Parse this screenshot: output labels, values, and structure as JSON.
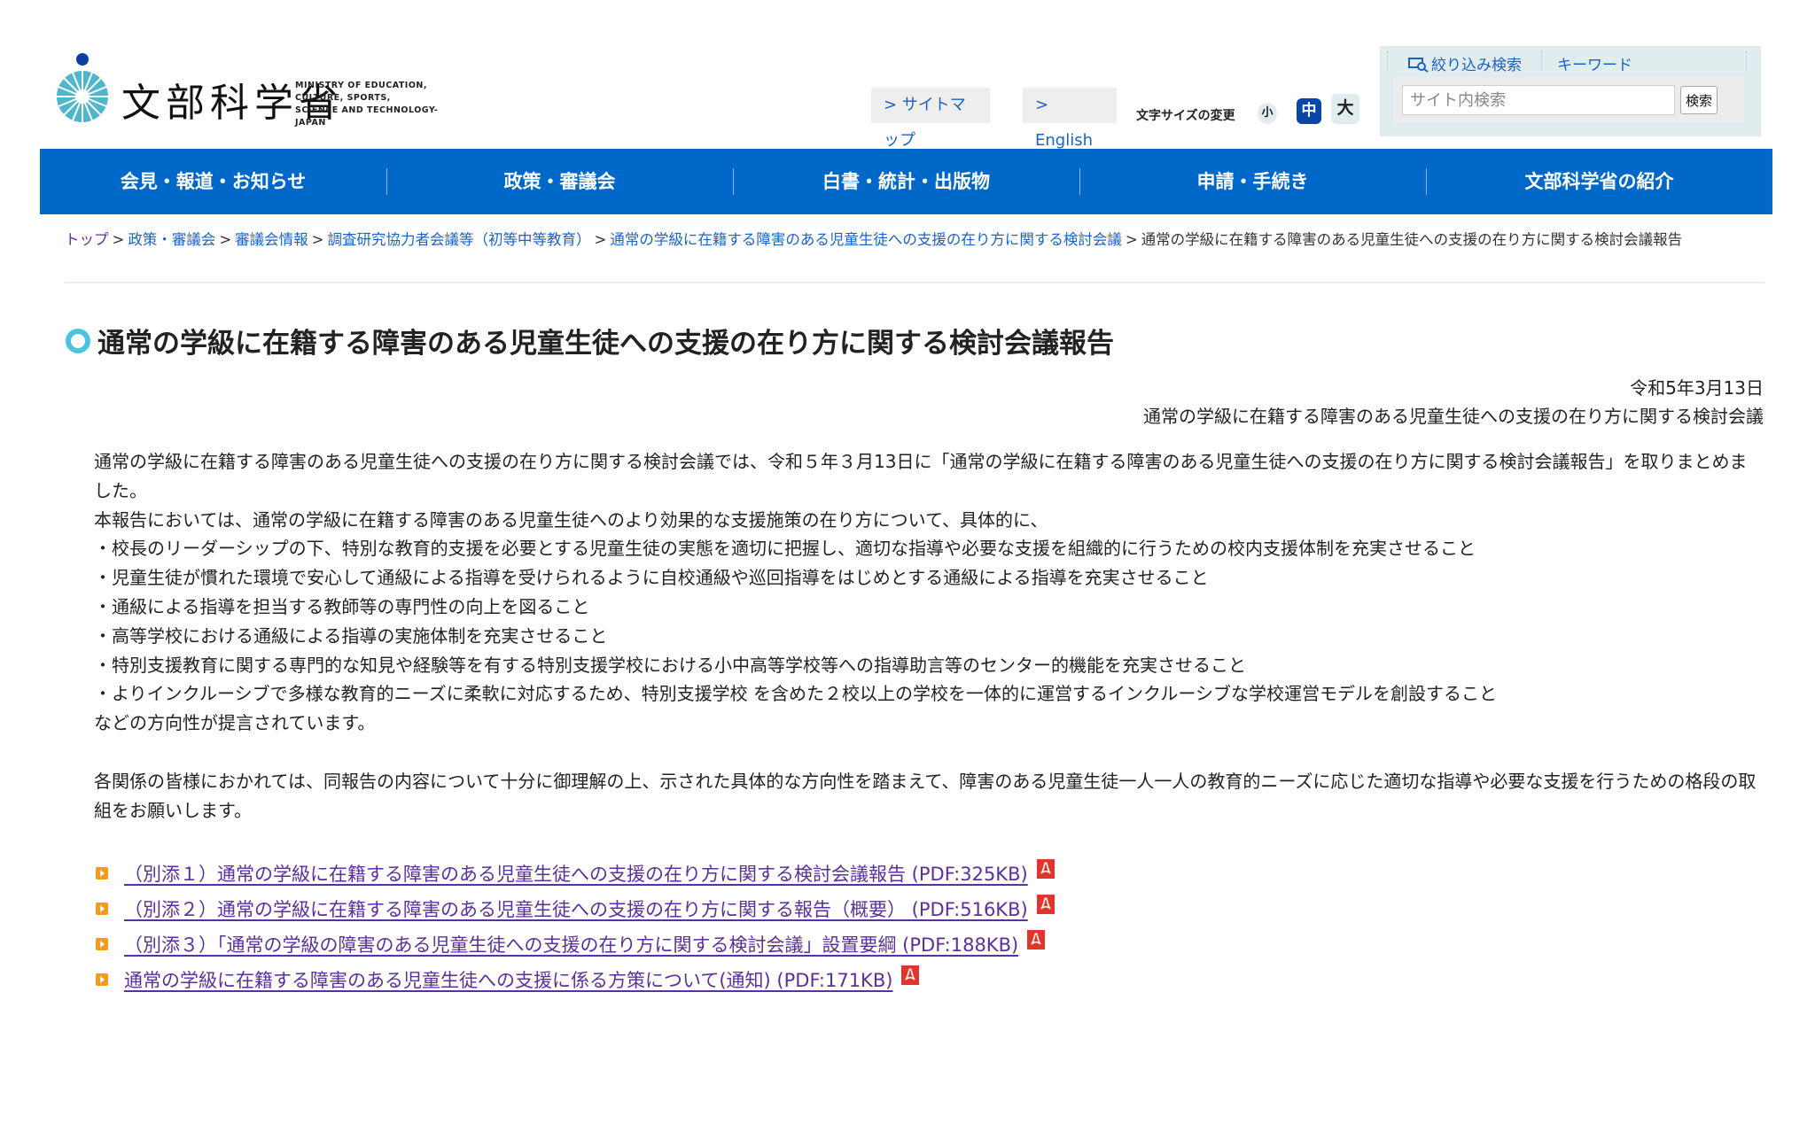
{
  "header": {
    "logo_kanji": "文部科学省",
    "logo_english": [
      "MINISTRY OF EDUCATION,",
      "CULTURE, SPORTS,",
      "SCIENCE AND TECHNOLOGY-JAPAN"
    ],
    "sitemap_label": "> サイトマップ",
    "english_label": "> English",
    "font_size_label": "文字サイズの変更",
    "font_sizes": {
      "small": "小",
      "medium": "中",
      "large": "大",
      "selected": "中"
    }
  },
  "search": {
    "filter_tab": "絞り込み検索",
    "keyword_tab": "キーワード",
    "placeholder": "サイト内検索",
    "value": "",
    "submit_label": "検索"
  },
  "nav": {
    "items": [
      {
        "label": "会見・報道・お知らせ"
      },
      {
        "label": "政策・審議会"
      },
      {
        "label": "白書・統計・出版物"
      },
      {
        "label": "申請・手続き"
      },
      {
        "label": "文部科学省の紹介"
      }
    ]
  },
  "breadcrumb": {
    "links": [
      "トップ",
      "政策・審議会",
      "審議会情報",
      "調査研究協力者会議等（初等中等教育）",
      "通常の学級に在籍する障害のある児童生徒への支援の在り方に関する検討会議"
    ],
    "current": "通常の学級に在籍する障害のある児童生徒への支援の在り方に関する検討会議報告",
    "separator": ">"
  },
  "page": {
    "title": "通常の学級に在籍する障害のある児童生徒への支援の在り方に関する検討会議報告",
    "date": "令和5年3月13日",
    "organization": "通常の学級に在籍する障害のある児童生徒への支援の在り方に関する検討会議",
    "paragraphs": [
      "通常の学級に在籍する障害のある児童生徒への支援の在り方に関する検討会議では、令和５年３月13日に「通常の学級に在籍する障害のある児童生徒への支援の在り方に関する検討会議報告」を取りまとめました。",
      "本報告においては、通常の学級に在籍する障害のある児童生徒へのより効果的な支援施策の在り方について、具体的に、",
      "・校長のリーダーシップの下、特別な教育的支援を必要とする児童生徒の実態を適切に把握し、適切な指導や必要な支援を組織的に行うための校内支援体制を充実させること",
      "・児童生徒が慣れた環境で安心して通級による指導を受けられるように自校通級や巡回指導をはじめとする通級による指導を充実させること",
      "・通級による指導を担当する教師等の専門性の向上を図ること",
      "・高等学校における通級による指導の実施体制を充実させること",
      "・特別支援教育に関する専門的な知見や経験等を有する特別支援学校における小中高等学校等への指導助言等のセンター的機能を充実させること",
      "・よりインクルーシブで多様な教育的ニーズに柔軟に対応するため、特別支援学校 を含めた２校以上の学校を一体的に運営するインクルーシブな学校運営モデルを創設すること",
      "などの方向性が提言されています。"
    ],
    "closing_paragraph": "各関係の皆様におかれては、同報告の内容について十分に御理解の上、示された具体的な方向性を踏まえて、障害のある児童生徒一人一人の教育的ニーズに応じた適切な指導や必要な支援を行うための格段の取組をお願いします。",
    "attachments": [
      {
        "label": "（別添１）通常の学級に在籍する障害のある児童生徒への支援の在り方に関する検討会議報告 (PDF:325KB)",
        "icon": "pdf-icon"
      },
      {
        "label": "（別添２）通常の学級に在籍する障害のある児童生徒への支援の在り方に関する報告（概要） (PDF:516KB)",
        "icon": "pdf-icon"
      },
      {
        "label": "（別添３）「通常の学級の障害のある児童生徒への支援の在り方に関する検討会議」設置要綱 (PDF:188KB)",
        "icon": "pdf-icon"
      },
      {
        "label": "通常の学級に在籍する障害のある児童生徒への支援に係る方策について(通知) (PDF:171KB)",
        "icon": "pdf-icon"
      }
    ]
  },
  "colors": {
    "nav_bg": "#0068c8",
    "link": "#1a63c6",
    "visited_link": "#5b2f9c",
    "accent_bullet": "#f29b1f",
    "pdf_red": "#e2352b",
    "title_icon": "#4dc3e0",
    "search_panel_bg": "#e1ecef",
    "font_size_selected": "#0a46a8"
  }
}
